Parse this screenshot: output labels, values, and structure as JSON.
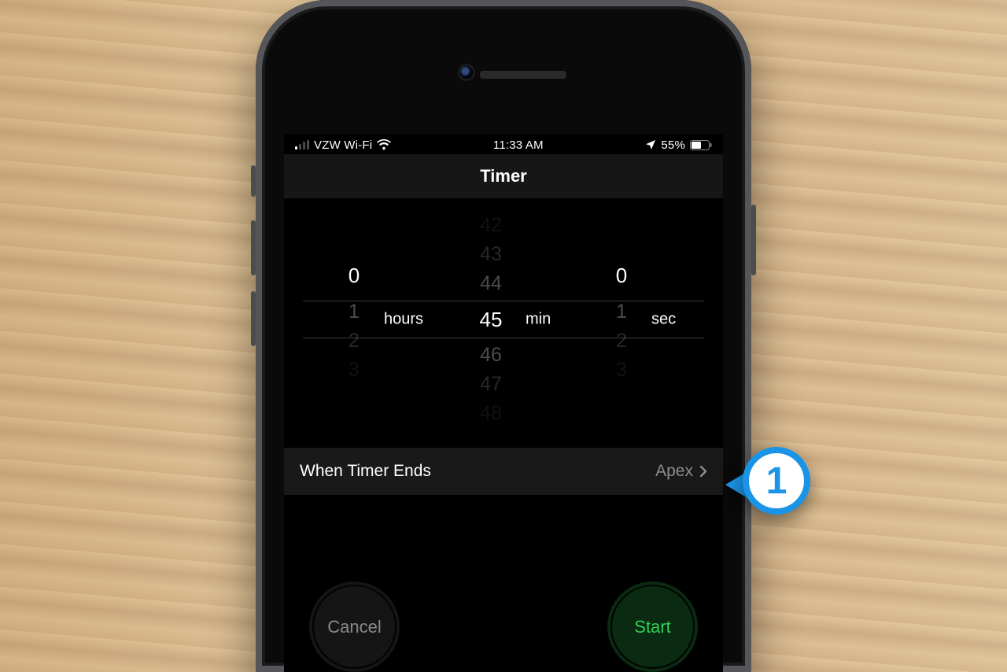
{
  "statusbar": {
    "carrier": "VZW Wi-Fi",
    "time": "11:33 AM",
    "battery_pct": "55%"
  },
  "header": {
    "title": "Timer"
  },
  "picker": {
    "hours": {
      "selected": "0",
      "below": [
        "1",
        "2",
        "3"
      ],
      "unit": "hours"
    },
    "minutes": {
      "above": [
        "42",
        "43",
        "44"
      ],
      "selected": "45",
      "below": [
        "46",
        "47",
        "48"
      ],
      "unit": "min"
    },
    "seconds": {
      "selected": "0",
      "below": [
        "1",
        "2",
        "3"
      ],
      "unit": "sec"
    }
  },
  "when_ends": {
    "label": "When Timer Ends",
    "value": "Apex"
  },
  "buttons": {
    "cancel": "Cancel",
    "start": "Start"
  },
  "callout": {
    "number": "1"
  }
}
